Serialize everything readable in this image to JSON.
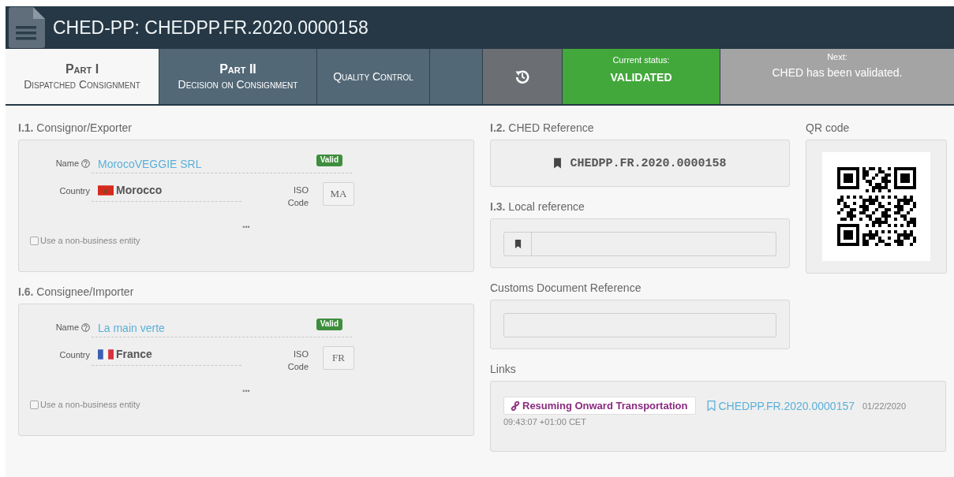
{
  "header": {
    "title": "CHED-PP: CHEDPP.FR.2020.0000158"
  },
  "tabs": [
    {
      "kind": "part",
      "label_top": "Part I",
      "label_bottom": "Dispatched Consignment",
      "selected": true
    },
    {
      "kind": "part",
      "label_top": "Part II",
      "label_bottom": "Decision on Consignment",
      "selected": false
    },
    {
      "kind": "single",
      "label": "Quality Control",
      "selected": false
    },
    {
      "kind": "empty",
      "selected": false
    }
  ],
  "status": {
    "caption": "Current status:",
    "value": "VALIDATED"
  },
  "next": {
    "caption": "Next:",
    "text": "CHED has been validated."
  },
  "parties": [
    {
      "number": "I.1.",
      "title": "Consignor/Exporter",
      "name_label": "Name",
      "name_value": "MorocoVEGGIE SRL",
      "badge": "Valid",
      "country_label": "Country",
      "flag": {
        "kind": "morocco"
      },
      "country": "Morocco",
      "iso_label": "ISO Code",
      "iso_value": "MA",
      "more": "•••",
      "checkbox": {
        "label": "Use a non-business entity",
        "checked": false
      }
    },
    {
      "number": "I.6.",
      "title": "Consignee/Importer",
      "name_label": "Name",
      "name_value": "La main verte",
      "badge": "Valid",
      "country_label": "Country",
      "flag": {
        "kind": "france"
      },
      "country": "France",
      "iso_label": "ISO Code",
      "iso_value": "FR",
      "more": "•••",
      "checkbox": {
        "label": "Use a non-business entity",
        "checked": false
      }
    }
  ],
  "ched_reference": {
    "number": "I.2.",
    "title": "CHED Reference",
    "value": "CHEDPP.FR.2020.0000158"
  },
  "local_reference": {
    "number": "I.3.",
    "title": "Local reference"
  },
  "customs_reference": {
    "title": "Customs Document Reference"
  },
  "qr": {
    "title": "QR code"
  },
  "links": {
    "title": "Links",
    "items": [
      {
        "type": "Resuming Onward Transportation",
        "reference": "CHEDPP.FR.2020.0000157",
        "date": "01/22/2020",
        "time": "09:43:07 +01:00 CET"
      }
    ]
  }
}
